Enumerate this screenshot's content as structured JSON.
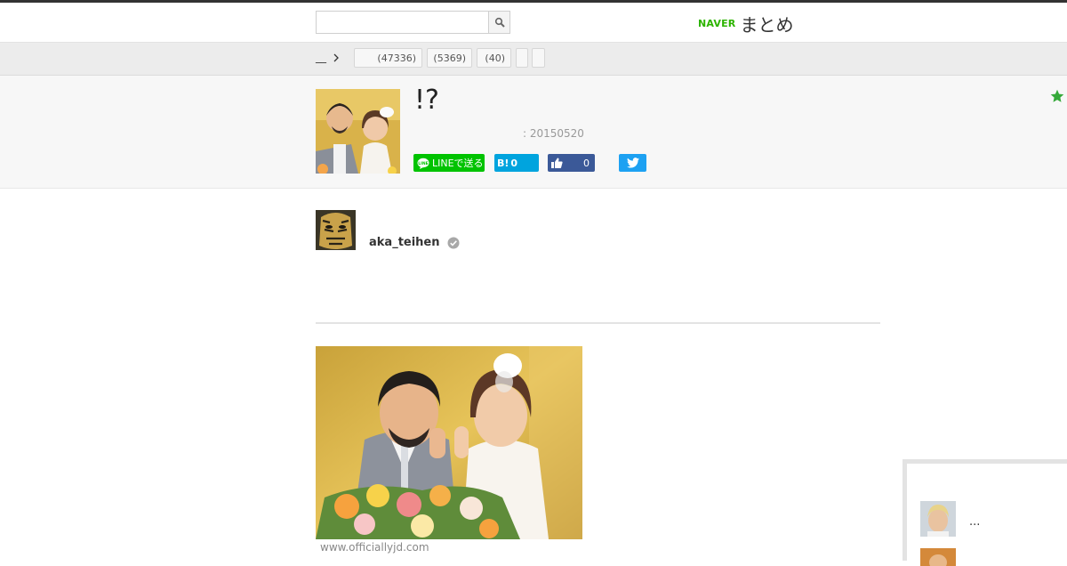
{
  "header": {
    "search": {
      "value": "",
      "placeholder": ""
    },
    "logo": {
      "naver": "NAVER",
      "matome": "まとめ"
    }
  },
  "categories": {
    "home_label": "__",
    "chips": [
      {
        "label": "(47336)"
      },
      {
        "label": "(5369)"
      },
      {
        "label": "(40)"
      },
      {
        "label": ""
      },
      {
        "label": ""
      }
    ]
  },
  "article": {
    "title": "!?",
    "date": ": 20150520",
    "share": {
      "line_label": "LINEで送る",
      "hatena_label": "B!",
      "hatena_count": "0",
      "facebook_count": "0"
    }
  },
  "author": {
    "name": "aka_teihen"
  },
  "content": {
    "source": "www.officiallyjd.com"
  },
  "sidebar": {
    "item_text": "..."
  },
  "colors": {
    "naver_green": "#2db400",
    "line_green": "#00c300",
    "hatena_blue": "#00a4de",
    "facebook_blue": "#3b5998",
    "twitter_blue": "#1da1f2",
    "star_green": "#35a93a"
  }
}
